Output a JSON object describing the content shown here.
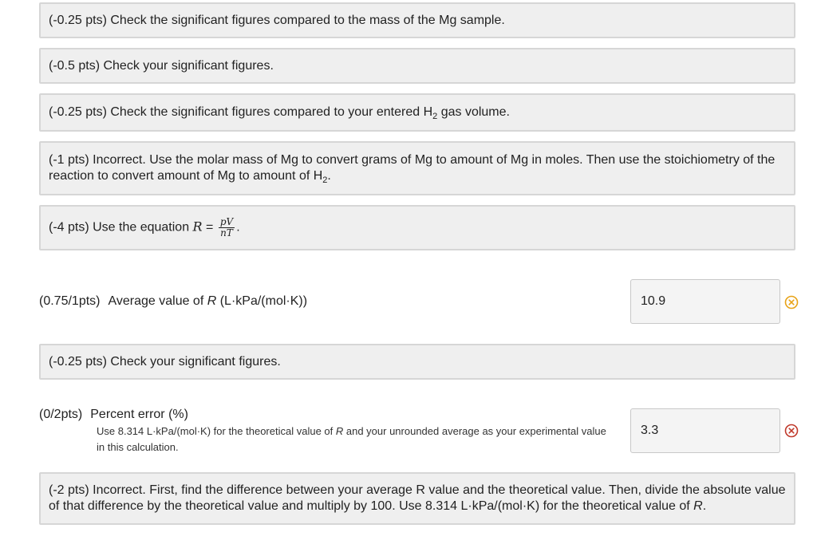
{
  "feedback": [
    {
      "text": "(-0.25 pts) Check the significant figures compared to the mass of the Mg sample."
    },
    {
      "text": "(-0.5 pts) Check your significant figures."
    },
    {
      "text_before": "(-0.25 pts) Check the significant figures compared to your entered H",
      "subscript": "2",
      "text_after": " gas volume."
    },
    {
      "text_before": "(-1 pts) Incorrect. Use the molar mass of Mg to convert grams of Mg to amount of Mg in moles. Then use the stoichiometry of the reaction to convert amount of Mg to amount of H",
      "subscript": "2",
      "text_after": "."
    },
    {
      "text_before": "(-4 pts) Use the equation ",
      "eq_lhs": "R",
      "eq_sign": " = ",
      "eq_num": "pV",
      "eq_den": "nT",
      "text_after": "."
    },
    {
      "text": "(-0.25 pts) Check your significant figures."
    },
    {
      "text_before": "(-2 pts) Incorrect. First, find the difference between your average R value and the theoretical value. Then, divide the absolute value of that difference by the theoretical value and multiply by 100. Use 8.314 L·kPa/(mol·K) for the theoretical value of ",
      "italic": "R",
      "text_after": "."
    }
  ],
  "question_r": {
    "score": "(0.75/1pts)",
    "label_before": "Average value of ",
    "label_italic": "R",
    "label_after": " (L·kPa/(mol·K))",
    "answer_value": "10.9",
    "status": "partially-correct",
    "status_icon": "x-circle-icon",
    "status_color": "#e8a317"
  },
  "question_pe": {
    "score": "(0/2pts)",
    "label": "Percent error (%)",
    "hint_before": "Use 8.314 L·kPa/(mol·K) for the theoretical value of ",
    "hint_italic": "R",
    "hint_after": " and your unrounded average as your experimental value in this calculation.",
    "answer_value": "3.3",
    "status": "incorrect",
    "status_icon": "x-circle-icon",
    "status_color": "#c0392b"
  }
}
